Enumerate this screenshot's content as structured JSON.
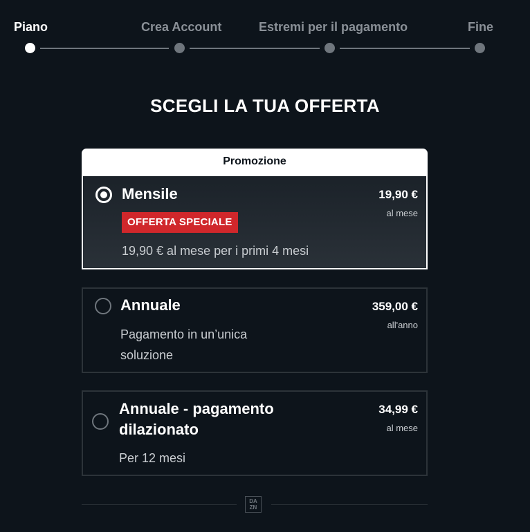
{
  "steps": [
    {
      "label": "Piano",
      "active": true
    },
    {
      "label": "Crea Account",
      "active": false
    },
    {
      "label": "Estremi per il pagamento",
      "active": false
    },
    {
      "label": "Fine",
      "active": false
    }
  ],
  "page_title": "SCEGLI LA TUA OFFERTA",
  "plans": [
    {
      "header": "Promozione",
      "name": "Mensile",
      "badge": "OFFERTA SPECIALE",
      "price": "19,90 €",
      "period": "al mese",
      "description": "19,90 € al mese per i primi 4 mesi",
      "selected": true
    },
    {
      "name": "Annuale",
      "price": "359,00 €",
      "period": "all'anno",
      "description_lines": [
        "Pagamento in un’unica",
        "soluzione"
      ],
      "selected": false
    },
    {
      "name_lines": [
        "Annuale - pagamento",
        "dilazionato"
      ],
      "price": "34,99 €",
      "period": "al mese",
      "description": "Per 12 mesi",
      "selected": false
    }
  ],
  "footer": {
    "logo_text": "DAZN",
    "logo_lines": [
      "DA",
      "ZN"
    ]
  },
  "colors": {
    "background": "#0d141b",
    "badge": "#d0272b",
    "border": "#2c3339",
    "muted": "#6f767d"
  }
}
